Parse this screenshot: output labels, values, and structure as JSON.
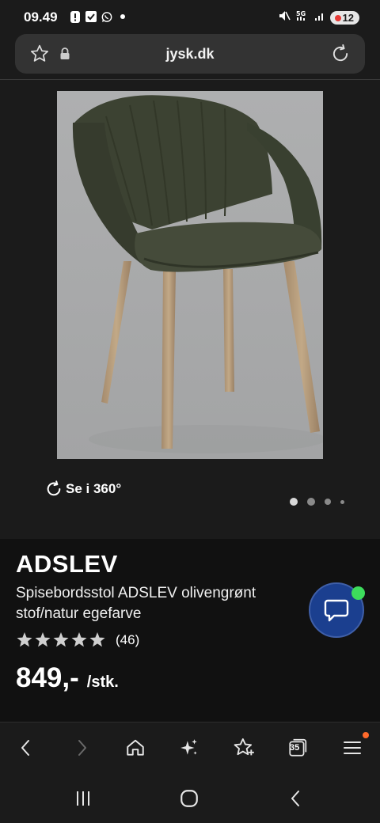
{
  "status_bar": {
    "time": "09.49",
    "battery": "12"
  },
  "url_bar": {
    "domain": "jysk.dk"
  },
  "gallery": {
    "spin_label": "Se i 360°",
    "dots_count": 4,
    "active_index": 0
  },
  "product": {
    "name": "ADSLEV",
    "description": "Spisebordsstol ADSLEV olivengrønt stof/natur egefarve",
    "rating_count": "(46)",
    "stars_total": 5,
    "price": "849,-",
    "unit": "/stk."
  },
  "toolbar": {
    "tabs_count": "35"
  },
  "colors": {
    "chat_button": "#1b3f8f",
    "online_indicator": "#3ddc5c",
    "menu_notification": "#ff6a2b"
  }
}
